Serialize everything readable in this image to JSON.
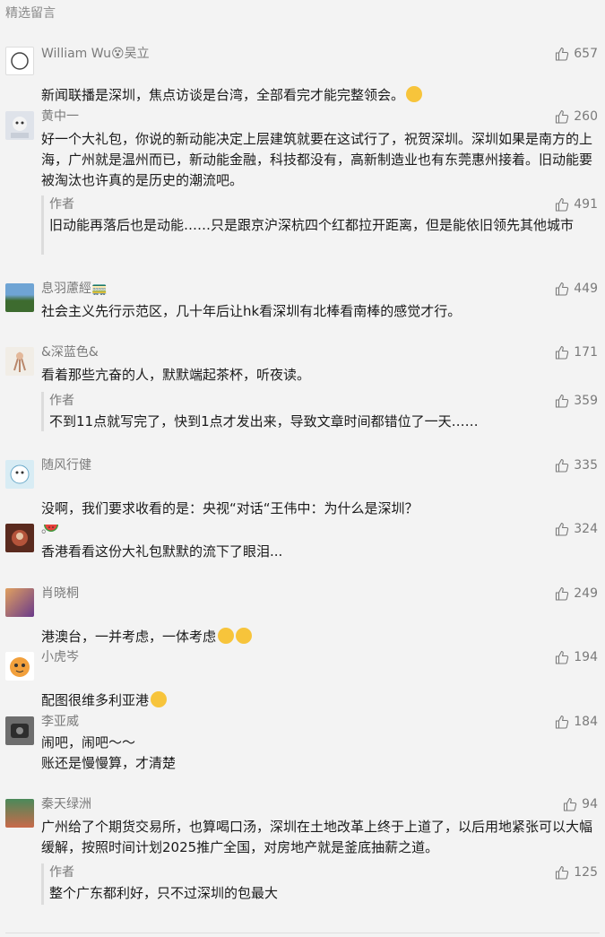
{
  "section_title": "精选留言",
  "comments": [
    {
      "nickname": "William Wu😵吴立",
      "likes": "657",
      "text": "新闻联播是深圳，焦点访谈是台湾，全部看完才能完整领会。",
      "emoji": "grin-emoji"
    },
    {
      "nickname": "黄中一",
      "likes": "260",
      "text": "好一个大礼包，你说的新动能决定上层建筑就要在这试行了，祝贺深圳。深圳如果是南方的上海，广州就是温州而已，新动能金融，科技都没有，高新制造业也有东莞惠州接着。旧动能要被淘汰也许真的是历史的潮流吧。",
      "reply": {
        "author": "作者",
        "likes": "491",
        "text": "旧动能再落后也是动能……只是跟京沪深杭四个红都拉开距离，但是能依旧领先其他城市"
      }
    },
    {
      "nickname": "息羽藘經🚃",
      "likes": "449",
      "text": "社会主义先行示范区，几十年后让hk看深圳有北棒看南棒的感觉才行。"
    },
    {
      "nickname": "&深蓝色&",
      "likes": "171",
      "text": "看着那些亢奋的人，默默端起茶杯，听夜读。",
      "reply": {
        "author": "作者",
        "likes": "359",
        "text": "不到11点就写完了，快到1点才发出来，导致文章时间都错位了一天……"
      }
    },
    {
      "nickname": "随风行健",
      "likes": "335",
      "text": "没啊，我们要求收看的是：央视“对话“王伟中：为什么是深圳？",
      "emoji": "watermelon-emoji"
    },
    {
      "nickname": "。",
      "likes": "324",
      "text": "香港看看这份大礼包默默的流下了眼泪..."
    },
    {
      "nickname": "肖晓桐",
      "likes": "249",
      "text": "港澳台，一并考虑，一体考虑",
      "emoji": "smile-grin-emoji"
    },
    {
      "nickname": "小虎岑",
      "likes": "194",
      "text": "配图很维多利亚港",
      "emoji": "laugh-tears-emoji"
    },
    {
      "nickname": "李亚威",
      "likes": "184",
      "text": "闹吧，闹吧～～\n账还是慢慢算，才清楚"
    },
    {
      "nickname": "秦天绿洲",
      "likes": "94",
      "text": "广州给了个期货交易所，也算喝口汤，深圳在土地改革上终于上道了，以后用地紧张可以大幅缓解，按照时间计划2025推广全国，对房地产就是釜底抽薪之道。",
      "reply": {
        "author": "作者",
        "likes": "125",
        "text": "整个广东都利好，只不过深圳的包最大"
      }
    }
  ]
}
